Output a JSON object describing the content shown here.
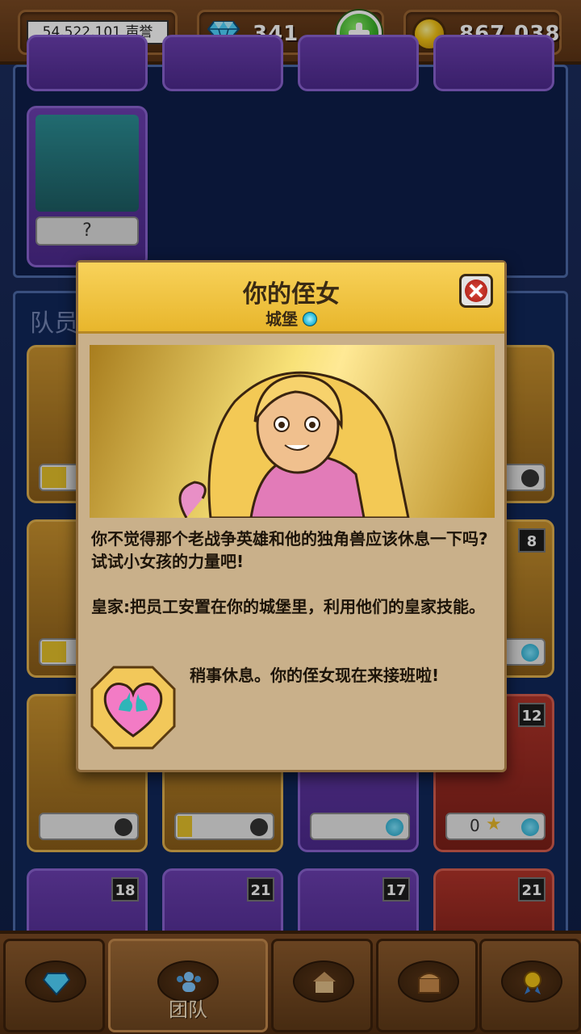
{
  "resources": {
    "fame": "54,522,101 声誉",
    "gems": "341",
    "gold": "867,038"
  },
  "top_panel": {
    "card": {
      "name": "?"
    }
  },
  "team_panel": {
    "label": "队员",
    "cards": [
      {
        "level": "8"
      },
      {
        "level": "12",
        "stars": "0"
      },
      {
        "level": "18"
      },
      {
        "level": "21"
      },
      {
        "level": "17"
      },
      {
        "level": "21"
      }
    ]
  },
  "dialog": {
    "title": "你的侄女",
    "subtitle": "城堡",
    "description": "你不觉得那个老战争英雄和他的独角兽应该休息一下吗?试试小女孩的力量吧!",
    "royal_text": "皇家:把员工安置在你的城堡里，利用他们的皇家技能。",
    "skill_text": "稍事休息。你的侄女现在来接班啦!",
    "skill_icon": "heart-unicorn-icon"
  },
  "bottom_nav": [
    {
      "icon": "diamond-icon",
      "label": ""
    },
    {
      "icon": "team-icon",
      "label": "团队",
      "active": true
    },
    {
      "icon": "castle-icon",
      "label": ""
    },
    {
      "icon": "chest-icon",
      "label": ""
    },
    {
      "icon": "medal-icon",
      "label": ""
    }
  ],
  "colors": {
    "header_gold": "#f8d25a",
    "dialog_bg": "#c9b08a",
    "wood": "#7a4a23",
    "panel_blue": "#11275a"
  }
}
